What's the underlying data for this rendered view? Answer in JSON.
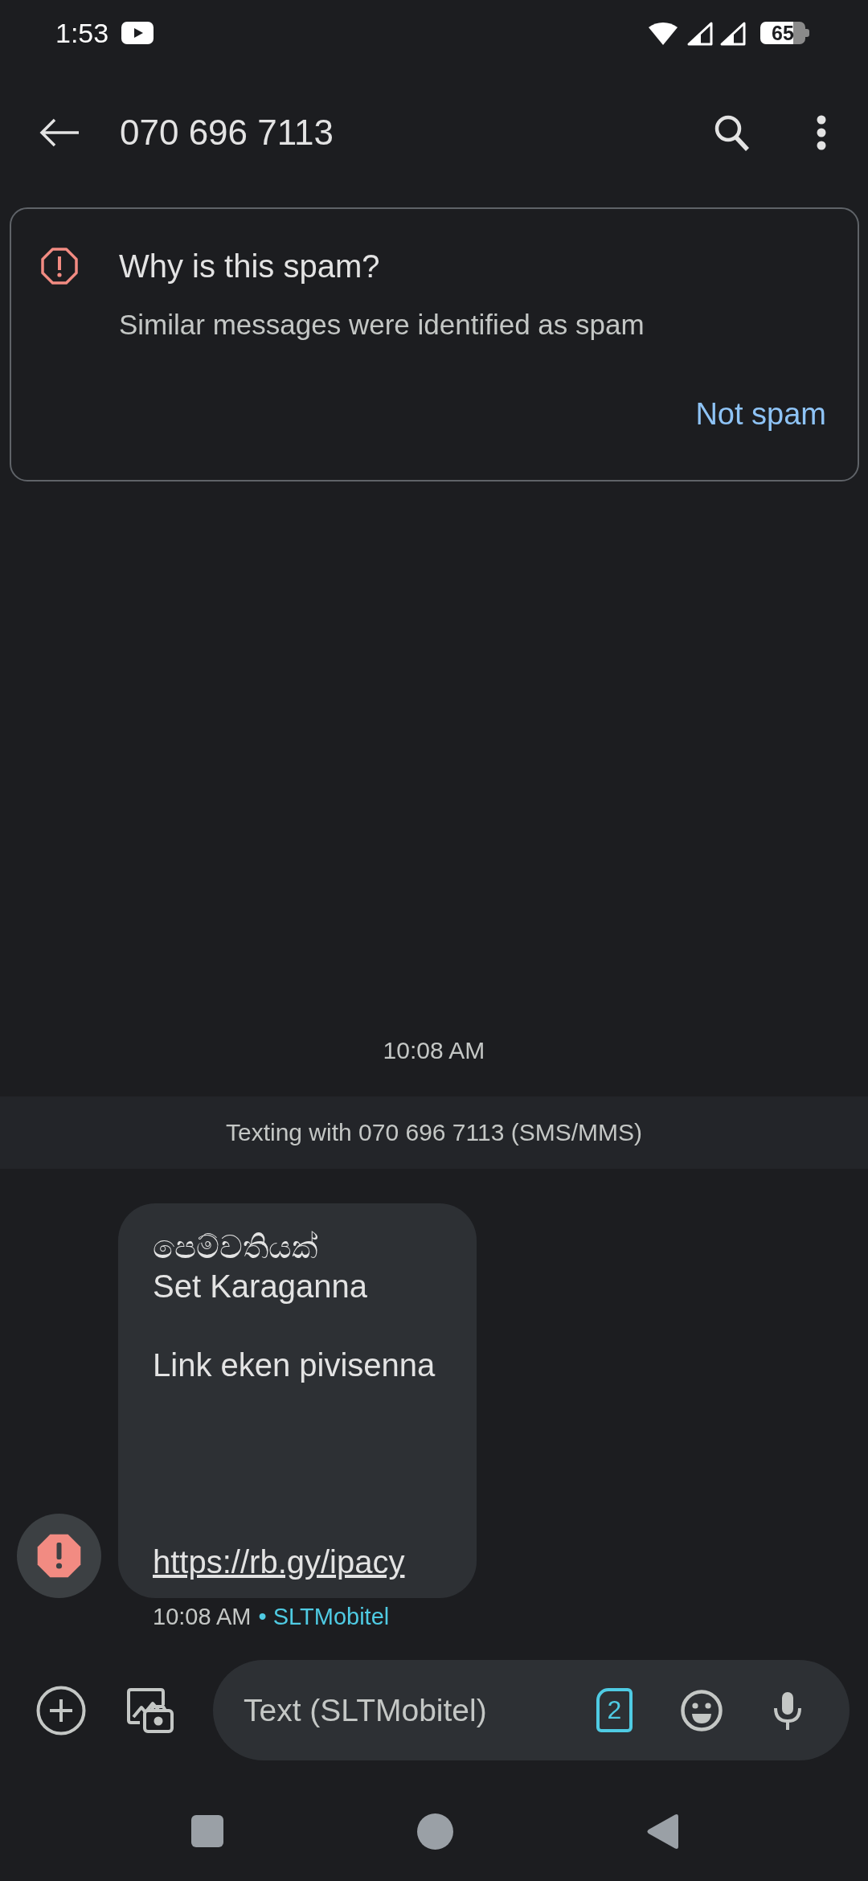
{
  "status_bar": {
    "time": "1:53",
    "battery": "65"
  },
  "top_bar": {
    "title": "070 696 7113"
  },
  "spam_card": {
    "title": "Why is this spam?",
    "description": "Similar messages were identified as spam",
    "action": "Not spam"
  },
  "conversation": {
    "timestamp": "10:08 AM",
    "banner": "Texting with 070 696 7113 (SMS/MMS)",
    "messages": [
      {
        "spam": true,
        "text": "පෙම්වතියක්\nSet Karaganna\n\nLink eken pivisenna\n\n\n\n\n",
        "link": "https://rb.gy/ipacy",
        "time": "10:08 AM",
        "separator": "•",
        "sim": "SLTMobitel"
      }
    ]
  },
  "compose": {
    "placeholder": "Text (SLTMobitel)",
    "sim_slot": "2"
  }
}
